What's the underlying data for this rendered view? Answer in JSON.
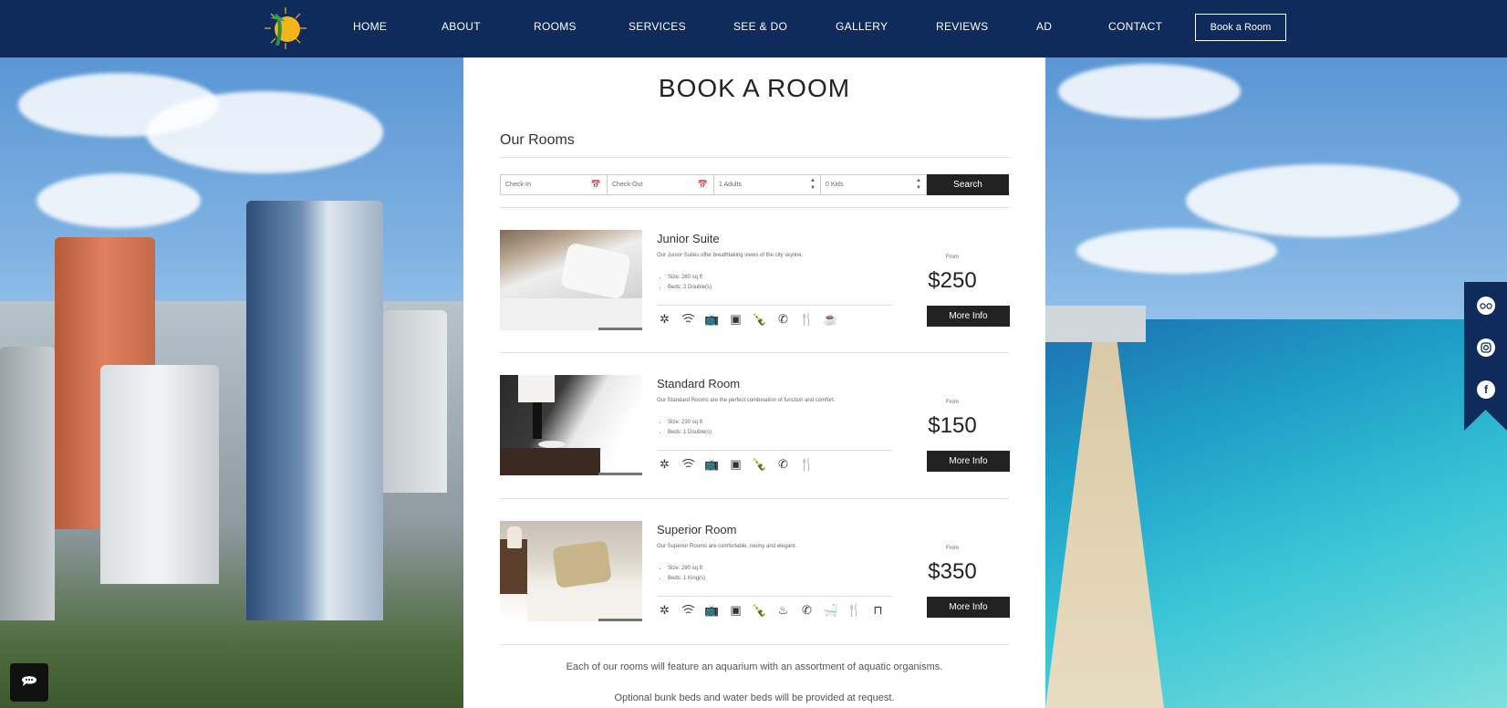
{
  "nav": {
    "items": [
      "HOME",
      "ABOUT",
      "ROOMS",
      "SERVICES",
      "SEE & DO",
      "GALLERY",
      "REVIEWS",
      "AD",
      "CONTACT"
    ],
    "cta": "Book a Room"
  },
  "page": {
    "title": "BOOK A ROOM",
    "subtitle": "Our Rooms"
  },
  "search": {
    "checkin": "Check-In",
    "checkout": "Check-Out",
    "adults": "1 Adults",
    "kids": "0 Kids",
    "button": "Search"
  },
  "rooms": [
    {
      "name": "Junior Suite",
      "desc": "Our Junior Suites offer breathtaking views of the city skyline.",
      "size": "Size: 260 sq ft",
      "beds": "Beds: 2 Double(s)",
      "from": "From",
      "price": "$250",
      "button": "More Info",
      "amenities": [
        "ac-icon",
        "wifi-icon",
        "tv-icon",
        "safe-icon",
        "minibar-icon",
        "phone-icon",
        "restaurant-icon",
        "coffee-icon"
      ]
    },
    {
      "name": "Standard Room",
      "desc": "Our Standard Rooms are the perfect combination of function and comfort.",
      "size": "Size: 230 sq ft",
      "beds": "Beds: 1 Double(s)",
      "from": "From",
      "price": "$150",
      "button": "More Info",
      "amenities": [
        "ac-icon",
        "wifi-icon",
        "tv-icon",
        "safe-icon",
        "minibar-icon",
        "phone-icon",
        "restaurant-icon"
      ]
    },
    {
      "name": "Superior Room",
      "desc": "Our Superior Rooms are comfortable, roomy and elegant.",
      "size": "Size: 280 sq ft",
      "beds": "Beds: 1 King(s)",
      "from": "From",
      "price": "$350",
      "button": "More Info",
      "amenities": [
        "ac-icon",
        "wifi-icon",
        "tv-icon",
        "safe-icon",
        "minibar-icon",
        "hairdryer-icon",
        "phone-icon",
        "bathtub-icon",
        "restaurant-icon",
        "desk-icon"
      ]
    }
  ],
  "notes": [
    "Each of our rooms will feature an aquarium with an assortment of aquatic organisms.",
    "Optional bunk beds and water beds will be provided at request."
  ],
  "social": [
    "tripadvisor-icon",
    "instagram-icon",
    "facebook-icon"
  ],
  "colors": {
    "nav": "#0e2b5c",
    "button": "#222222",
    "logo_sun": "#f2b51c"
  }
}
